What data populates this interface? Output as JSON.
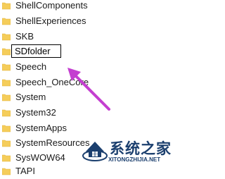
{
  "folders": [
    {
      "name": "ShellComponents"
    },
    {
      "name": "ShellExperiences"
    },
    {
      "name": "SKB"
    },
    {
      "name": "SDfolder",
      "editing": true
    },
    {
      "name": "Speech"
    },
    {
      "name": "Speech_OneCore"
    },
    {
      "name": "System"
    },
    {
      "name": "System32"
    },
    {
      "name": "SystemApps"
    },
    {
      "name": "SystemResources"
    },
    {
      "name": "SysWOW64"
    },
    {
      "name": "TAPI"
    }
  ],
  "rename_input": {
    "value": "SDfolder"
  },
  "colors": {
    "folder": "#f5cd5a",
    "folder_dark": "#e2b33c",
    "arrow": "#c43fd0",
    "watermark": "#1b3f6e"
  },
  "watermark": {
    "title": "系统之家",
    "url": "XITONGZHIJIA.NET"
  }
}
